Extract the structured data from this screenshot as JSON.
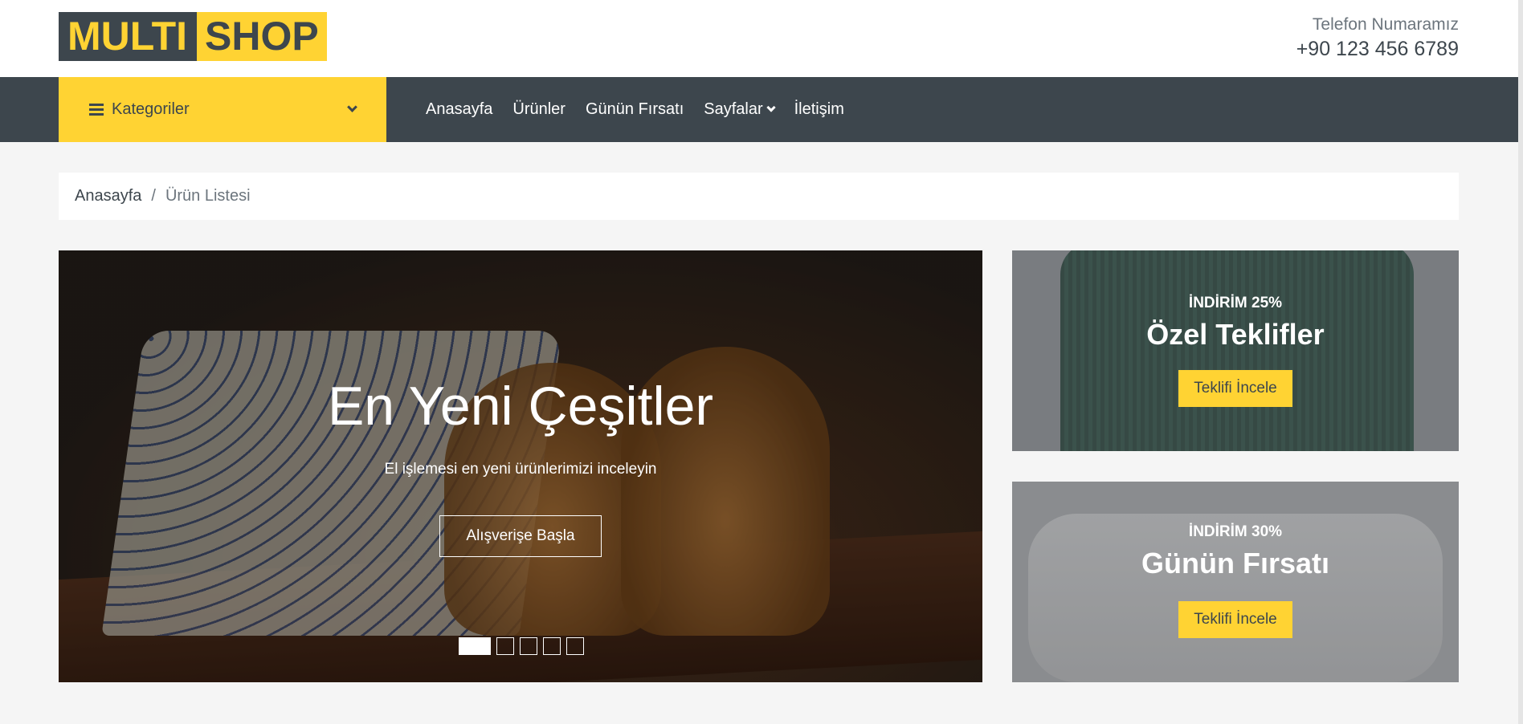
{
  "header": {
    "logo_part1": "MULTI",
    "logo_part2": "SHOP",
    "phone_label": "Telefon Numaramız",
    "phone_number": "+90 123 456 6789"
  },
  "nav": {
    "categories_label": "Kategoriler",
    "links": [
      "Anasayfa",
      "Ürünler",
      "Günün Fırsatı",
      "Sayfalar",
      "İletişim"
    ]
  },
  "breadcrumb": {
    "home": "Anasayfa",
    "separator": "/",
    "current": "Ürün Listesi"
  },
  "carousel": {
    "title": "En Yeni Çeşitler",
    "subtitle": "El işlemesi en yeni ürünlerimizi inceleyin",
    "button": "Alışverişe Başla",
    "slide_count": 5,
    "active_slide": 1
  },
  "offers": [
    {
      "discount": "İNDİRİM 25%",
      "title": "Özel Teklifler",
      "button": "Teklifi İncele"
    },
    {
      "discount": "İNDİRİM 30%",
      "title": "Günün Fırsatı",
      "button": "Teklifi İncele"
    }
  ],
  "colors": {
    "accent": "#ffd333",
    "dark": "#3d464d",
    "background": "#f5f5f5"
  }
}
